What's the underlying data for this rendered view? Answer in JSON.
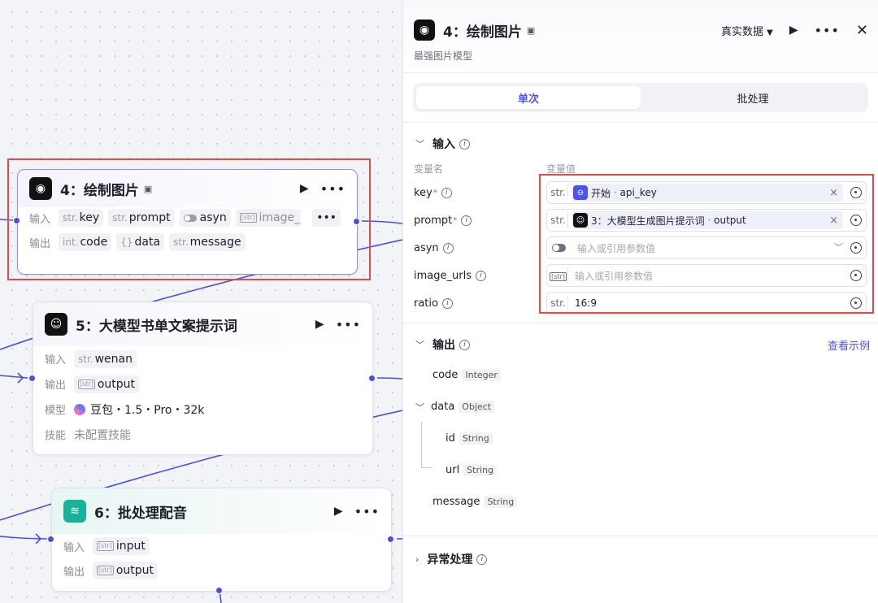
{
  "canvas": {
    "node4": {
      "title": "4：绘制图片",
      "input_label": "输入",
      "output_label": "输出",
      "inputs": [
        {
          "type": "str.",
          "name": "key"
        },
        {
          "type": "str.",
          "name": "prompt"
        },
        {
          "type": "toggle",
          "name": "asyn"
        },
        {
          "type": "[str]",
          "name": "image_url"
        }
      ],
      "outputs": [
        {
          "type": "int.",
          "name": "code"
        },
        {
          "type": "{}",
          "name": "data"
        },
        {
          "type": "str.",
          "name": "message"
        }
      ]
    },
    "node5": {
      "title": "5：大模型书单文案提示词",
      "input_label": "输入",
      "output_label": "输出",
      "model_label": "模型",
      "skill_label": "技能",
      "input": {
        "type": "str.",
        "name": "wenan"
      },
      "output": {
        "type": "[str]",
        "name": "output"
      },
      "model": "豆包・1.5・Pro・32k",
      "skill": "未配置技能"
    },
    "node6": {
      "title": "6：批处理配音",
      "input_label": "输入",
      "output_label": "输出",
      "input": {
        "type": "[str]",
        "name": "input"
      },
      "output": {
        "type": "[str]",
        "name": "output"
      }
    }
  },
  "panel": {
    "title": "4：绘制图片",
    "subtitle": "最强图片模型",
    "real_data": "真实数据",
    "tabs": [
      {
        "label": "单次",
        "active": true
      },
      {
        "label": "批处理",
        "active": false
      }
    ],
    "input_section": "输入",
    "col_name": "变量名",
    "col_value": "变量值",
    "inputs": [
      {
        "name": "key",
        "required": true,
        "type": "str.",
        "ref_node": "开始",
        "ref_var": "api_key"
      },
      {
        "name": "prompt",
        "required": true,
        "type": "str.",
        "ref_node": "3：大模型生成图片提示词",
        "ref_var": "output"
      },
      {
        "name": "asyn",
        "required": false,
        "type": "toggle",
        "placeholder": "输入或引用参数值"
      },
      {
        "name": "image_urls",
        "required": false,
        "type": "[str]",
        "placeholder": "输入或引用参数值"
      },
      {
        "name": "ratio",
        "required": false,
        "type": "str.",
        "value": "16:9"
      }
    ],
    "output_section": "输出",
    "view_example": "查看示例",
    "outputs": [
      {
        "name": "code",
        "type": "Integer"
      },
      {
        "name": "data",
        "type": "Object"
      },
      {
        "name": "id",
        "type": "String"
      },
      {
        "name": "url",
        "type": "String"
      },
      {
        "name": "message",
        "type": "String"
      }
    ],
    "error_section": "异常处理",
    "required_mark": "*",
    "ref_separator": "·",
    "clear_mark": "×"
  },
  "colors": {
    "accent": "#4d53e8",
    "highlight": "#e34b47",
    "edge": "#4a4fe0"
  }
}
